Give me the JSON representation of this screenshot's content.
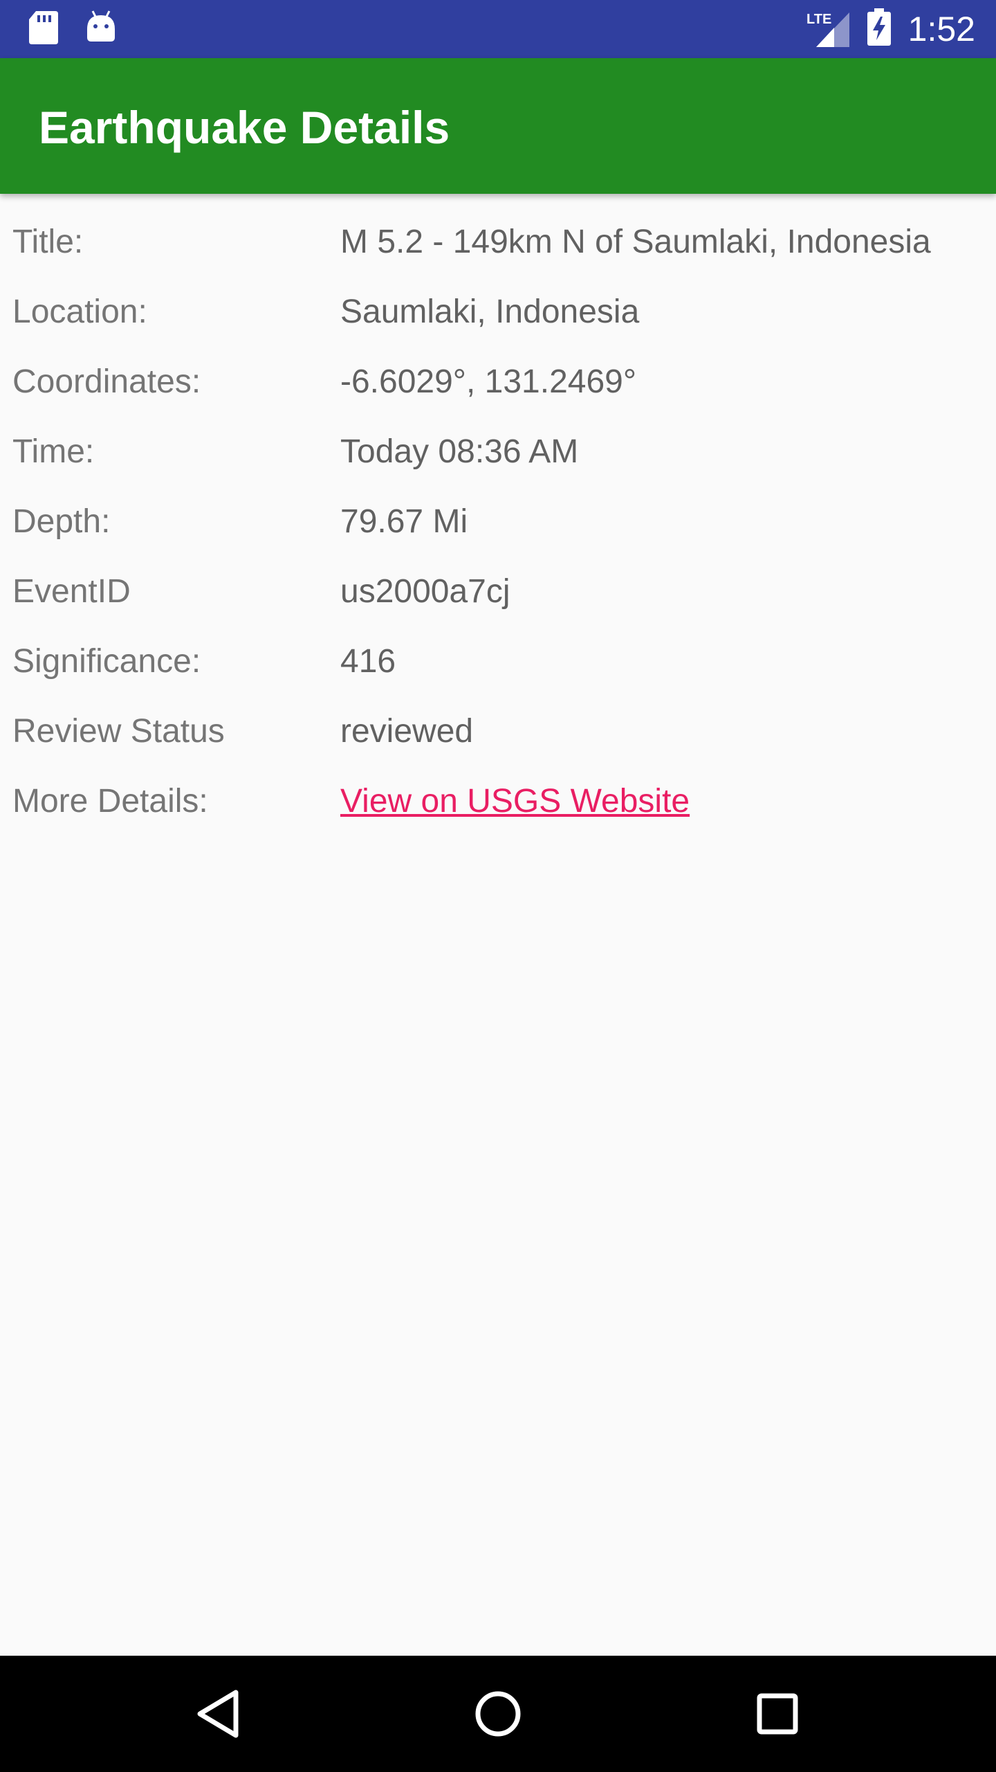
{
  "status_bar": {
    "time": "1:52",
    "network": "LTE",
    "icons": [
      "sd-card-icon",
      "android-icon",
      "lte-signal-icon",
      "battery-charging-icon"
    ]
  },
  "app_bar": {
    "title": "Earthquake Details",
    "color": "#228b22"
  },
  "details": [
    {
      "label": "Title:",
      "value": "M 5.2 - 149km N of Saumlaki, Indonesia"
    },
    {
      "label": "Location:",
      "value": "Saumlaki, Indonesia"
    },
    {
      "label": "Coordinates:",
      "value": "-6.6029°, 131.2469°"
    },
    {
      "label": "Time:",
      "value": "Today 08:36 AM"
    },
    {
      "label": "Depth:",
      "value": "79.67 Mi"
    },
    {
      "label": "EventID",
      "value": "us2000a7cj"
    },
    {
      "label": "Significance:",
      "value": "416"
    },
    {
      "label": "Review Status",
      "value": "reviewed"
    },
    {
      "label": "More Details:",
      "value": "View on USGS Website",
      "link_color": "#e91e63"
    }
  ],
  "nav_bar": {
    "buttons": [
      "back-icon",
      "home-icon",
      "recents-icon"
    ]
  }
}
